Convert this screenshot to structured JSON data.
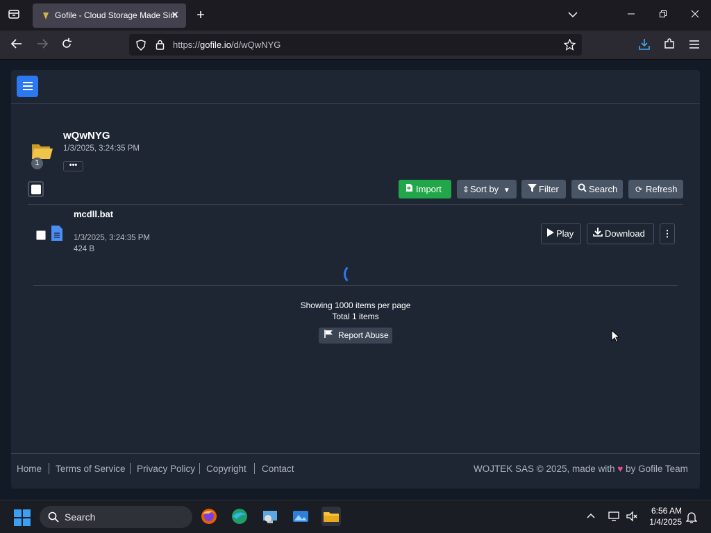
{
  "browser": {
    "tab_title": "Gofile - Cloud Storage Made Simple",
    "url_prefix": "https://",
    "url_host": "gofile.io",
    "url_path": "/d/wQwNYG"
  },
  "folder": {
    "name": "wQwNYG",
    "date": "1/3/2025, 3:24:35 PM",
    "badge": "1",
    "more_label": "•••"
  },
  "toolbar": {
    "import": "Import",
    "sort": "Sort by",
    "filter": "Filter",
    "search": "Search",
    "refresh": "Refresh"
  },
  "files": [
    {
      "name": "mcdll.bat",
      "date": "1/3/2025, 3:24:35 PM",
      "size": "424 B",
      "play": "Play",
      "download": "Download"
    }
  ],
  "pagination": {
    "per_page_text": "Showing 1000 items per page",
    "total_text": "Total 1 items",
    "report": "Report Abuse"
  },
  "footer": {
    "links": [
      "Home",
      "Terms of Service",
      "Privacy Policy",
      "Copyright",
      "Contact"
    ],
    "credit_left": "WOJTEK SAS © 2025, made with",
    "credit_right": "by Gofile Team"
  },
  "taskbar": {
    "search_placeholder": "Search",
    "time": "6:56 AM",
    "date": "1/4/2025"
  },
  "colors": {
    "accent": "#2b78f0",
    "import_green": "#21a64a",
    "background": "#1e2633"
  }
}
